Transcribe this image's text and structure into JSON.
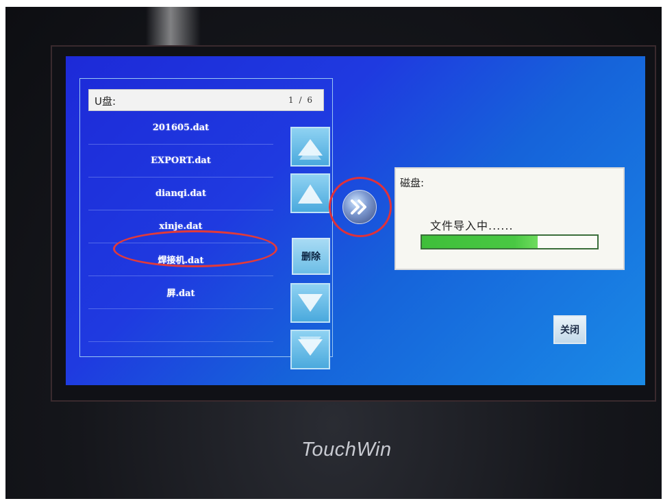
{
  "list": {
    "header_label": "U盘:",
    "page_indicator": "1 / 6",
    "files": [
      {
        "name": "201605.dat"
      },
      {
        "name": "EXPORT.dat"
      },
      {
        "name": "dianqi.dat"
      },
      {
        "name": "xinje.dat"
      },
      {
        "name": "焊接机.dat"
      },
      {
        "name": "屏.dat"
      },
      {
        "name": ""
      }
    ],
    "delete_label": "删除"
  },
  "disk": {
    "title": "磁盘:",
    "status": "文件导入中......",
    "progress_fraction": 0.66
  },
  "close_label": "关闭",
  "brand": "TouchWin",
  "icons": {
    "scroll_top": "double-up-icon",
    "scroll_up": "up-icon",
    "scroll_down": "down-icon",
    "scroll_bottom": "double-down-icon",
    "transfer": "double-chevron-right-icon"
  },
  "colors": {
    "screen_bg": "#1f3ae0",
    "highlight_ring": "#e23a3a",
    "progress_fill": "#3fbf3a"
  }
}
